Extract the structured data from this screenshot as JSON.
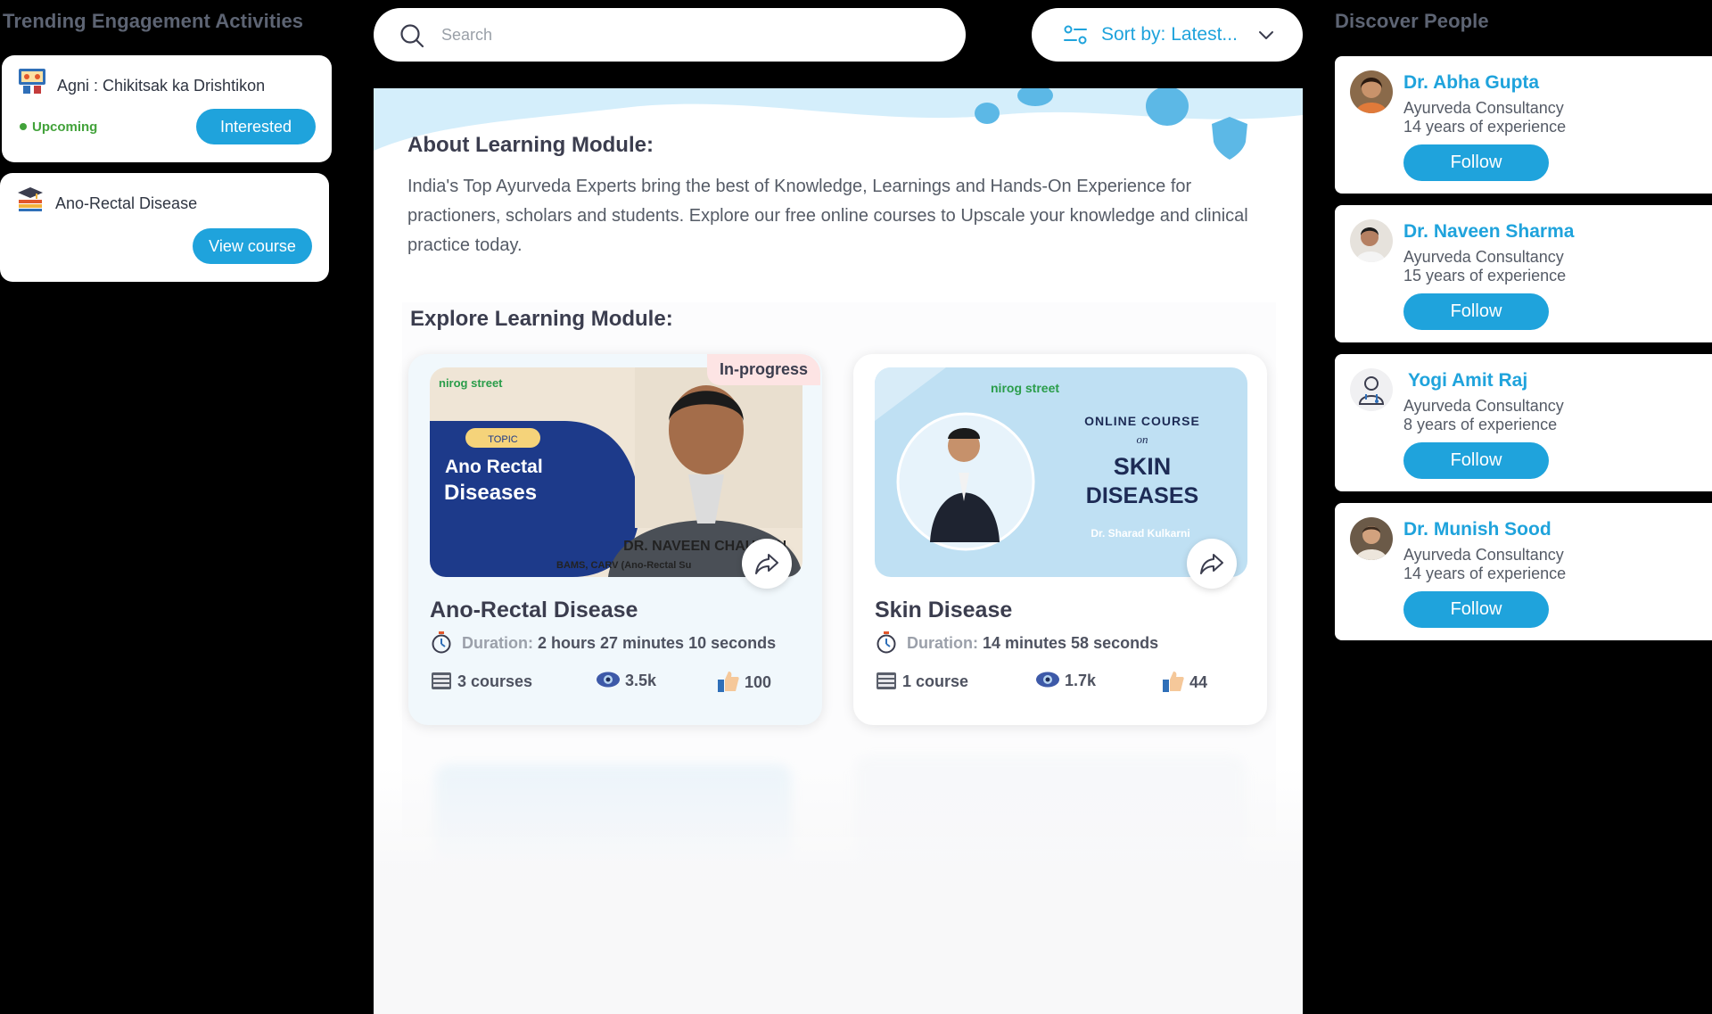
{
  "trending": {
    "title": "Trending Engagement Activities",
    "activities": [
      {
        "title": "Agni : Chikitsak ka Drishtikon",
        "status": "Upcoming",
        "button": "Interested",
        "icon": "presenter-icon"
      },
      {
        "title": "Ano-Rectal Disease",
        "button": "View course",
        "icon": "graduation-books-icon"
      }
    ]
  },
  "search": {
    "placeholder": "Search",
    "value": ""
  },
  "sort": {
    "label": "Sort by: Latest..."
  },
  "about": {
    "title": "About Learning Module:",
    "text": "India's Top Ayurveda Experts bring the best of Knowledge, Learnings and Hands-On Experience for practioners, scholars and students. Explore our free online courses to Upscale your knowledge and clinical practice today."
  },
  "explore": {
    "title": "Explore Learning Module:",
    "duration_label": "Duration:",
    "courses": [
      {
        "badge": "In-progress",
        "thumb_logo": "nirog street",
        "thumb_topic": "TOPIC",
        "thumb_title_1": "Ano Rectal",
        "thumb_title_2": "Diseases",
        "thumb_doctor": "DR. NAVEEN CHAUHAN",
        "thumb_degree": "BAMS, CARV (Ano-Rectal Su",
        "title": "Ano-Rectal Disease",
        "duration": "2 hours 27 minutes 10 seconds",
        "courses_count": "3 courses",
        "views": "3.5k",
        "likes": "100"
      },
      {
        "thumb_logo": "nirog street",
        "thumb_online": "ONLINE COURSE",
        "thumb_on": "on",
        "thumb_title_1": "SKIN",
        "thumb_title_2": "DISEASES",
        "thumb_doctor": "Dr. Sharad Kulkarni",
        "title": "Skin Disease",
        "duration": "14 minutes 58 seconds",
        "courses_count": "1 course",
        "views": "1.7k",
        "likes": "44"
      }
    ]
  },
  "discover": {
    "title": "Discover People",
    "follow_label": "Follow",
    "people": [
      {
        "name": "Dr. Abha Gupta",
        "role": "Ayurveda Consultancy",
        "experience": "14 years of experience"
      },
      {
        "name": "Dr. Naveen Sharma",
        "role": "Ayurveda Consultancy",
        "experience": "15 years of experience"
      },
      {
        "name": "Yogi Amit Raj",
        "role": "Ayurveda Consultancy",
        "experience": "8 years of experience"
      },
      {
        "name": "Dr. Munish Sood",
        "role": "Ayurveda Consultancy",
        "experience": "14 years of experience"
      }
    ]
  },
  "colors": {
    "accent": "#1fa3dc",
    "upcoming": "#42a23a",
    "badge_bg": "#fde4e4",
    "text_dark": "#3b3d4e"
  }
}
